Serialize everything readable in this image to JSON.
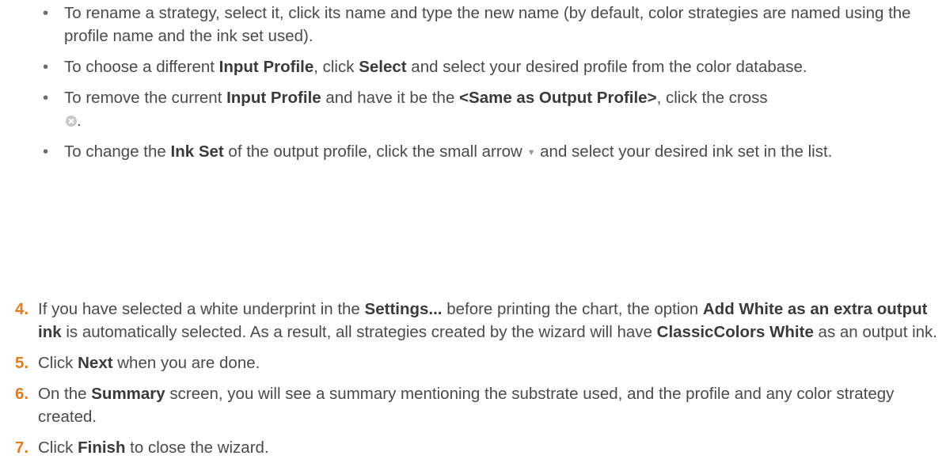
{
  "bullets": [
    {
      "parts": [
        "To rename a strategy, select it, click its name and type the new name (by default, color strategies are named using the profile name and the ink set used)."
      ]
    },
    {
      "parts": [
        "To choose a different ",
        "Input Profile",
        ", click ",
        "Select",
        " and select your desired profile from the color database."
      ]
    },
    {
      "parts": [
        "To remove the current ",
        "Input Profile",
        " and have it be the ",
        "<Same as Output Profile>",
        ", click the cross ",
        "."
      ]
    },
    {
      "parts": [
        "To change the ",
        "Ink Set",
        " of the output profile, click the small arrow ",
        " and select your desired ink set in the list."
      ]
    }
  ],
  "steps": [
    {
      "number": "4.",
      "parts": [
        "If you have selected a white underprint in the ",
        "Settings...",
        " before printing the chart, the option ",
        "Add White as an extra output ink",
        " is automatically selected. As a result, all strategies created by the wizard will have ",
        "ClassicColors White",
        " as an output ink."
      ]
    },
    {
      "number": "5.",
      "parts": [
        "Click ",
        "Next",
        " when you are done."
      ]
    },
    {
      "number": "6.",
      "parts": [
        "On the ",
        "Summary",
        " screen, you will see a summary mentioning the substrate used, and the profile and any color strategy created."
      ]
    },
    {
      "number": "7.",
      "parts": [
        "Click ",
        "Finish",
        " to close the wizard."
      ]
    }
  ],
  "icons": {
    "cross": "cross-circle-icon",
    "arrow": "dropdown-arrow-icon"
  },
  "colors": {
    "step_number": "#e07b1f",
    "text": "#4a4a4a"
  }
}
